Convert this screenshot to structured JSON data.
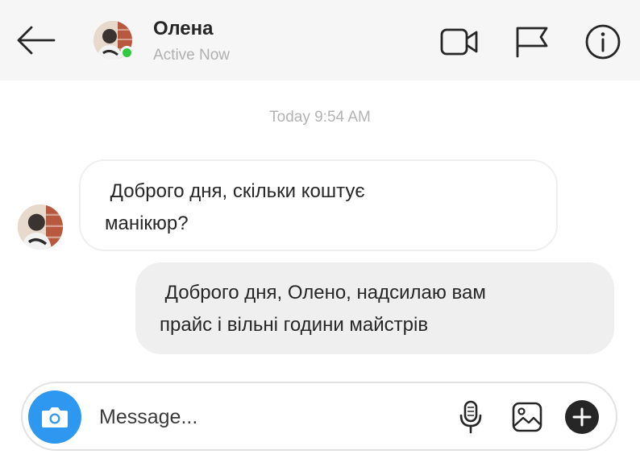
{
  "header": {
    "contact_name": "Олена",
    "status": "Active Now",
    "status_color": "#31c93f",
    "icons": [
      "back-arrow-icon",
      "video-call-icon",
      "report-flag-icon",
      "info-icon"
    ]
  },
  "conversation": {
    "timestamp": "Today 9:54 AM",
    "messages": [
      {
        "direction": "incoming",
        "text": " Доброго дня, скільки коштує\nманікюр?"
      },
      {
        "direction": "outgoing",
        "text": " Доброго дня, Олено, надсилаю вам\nпрайс і вільні години майстрів"
      }
    ]
  },
  "composer": {
    "placeholder": "Message...",
    "value": "",
    "accent_color": "#2e97f0",
    "icons": [
      "camera-icon",
      "microphone-icon",
      "gallery-icon",
      "plus-icon"
    ]
  }
}
